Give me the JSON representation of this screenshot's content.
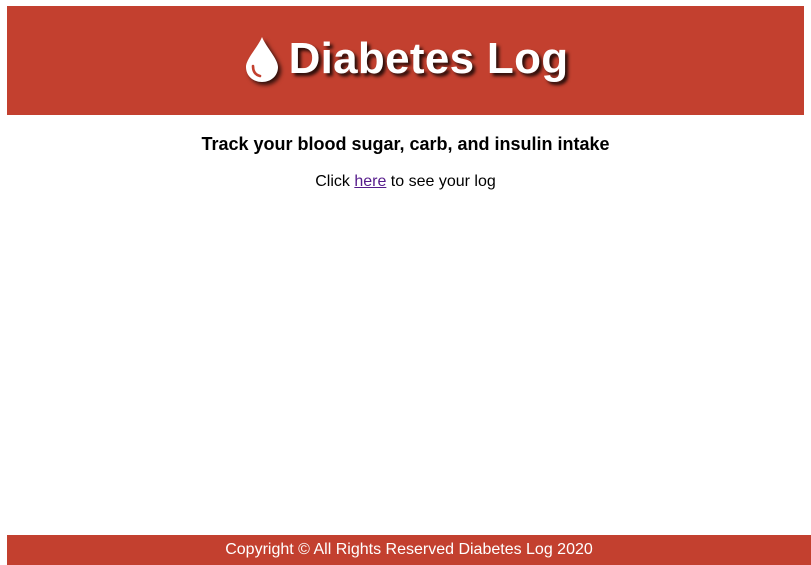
{
  "header": {
    "title": "Diabetes Log",
    "icon": "blood-drop-icon",
    "background": "#c3402f"
  },
  "main": {
    "tagline": "Track your blood sugar, carb, and insulin intake",
    "cta_prefix": "Click ",
    "cta_link": "here",
    "cta_suffix": " to see your log",
    "link_color": "#551a8b"
  },
  "footer": {
    "text": "Copyright © All Rights Reserved Diabetes Log 2020"
  }
}
